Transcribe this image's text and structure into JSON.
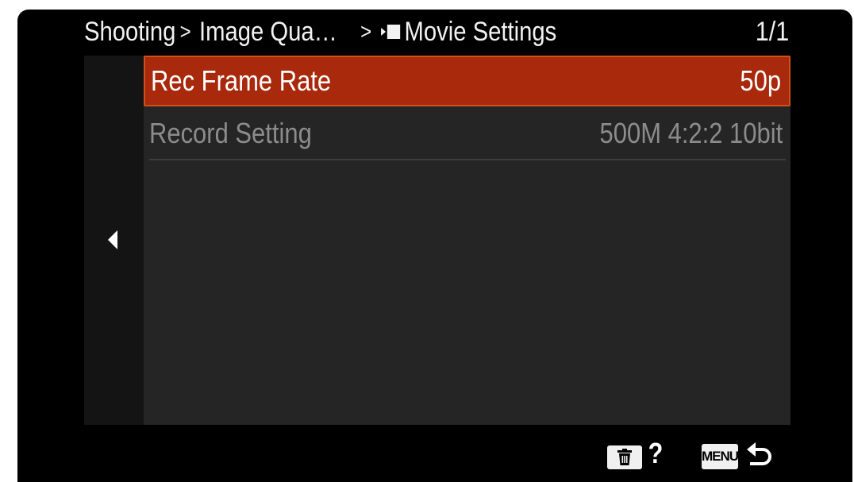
{
  "header": {
    "crumb1": "Shooting",
    "sep1": ">",
    "crumb2": "Image Qua…",
    "sep2": ">",
    "crumb3": "Movie Settings",
    "page": "1/1"
  },
  "menu": {
    "items": [
      {
        "label": "Rec Frame Rate",
        "value": "50p",
        "state": "selected"
      },
      {
        "label": "Record Setting",
        "value": "500M 4:2:2 10bit",
        "state": "normal"
      }
    ]
  },
  "footer": {
    "help": "?",
    "menu_label": "MENU",
    "icons": [
      "trash-icon",
      "help-icon",
      "menu-icon",
      "back-icon"
    ]
  },
  "colors": {
    "highlight": "#a8290b",
    "highlight_border": "#d0501c",
    "panel": "#252525",
    "rail": "#141414",
    "text_dim": "#8c8c8c"
  }
}
